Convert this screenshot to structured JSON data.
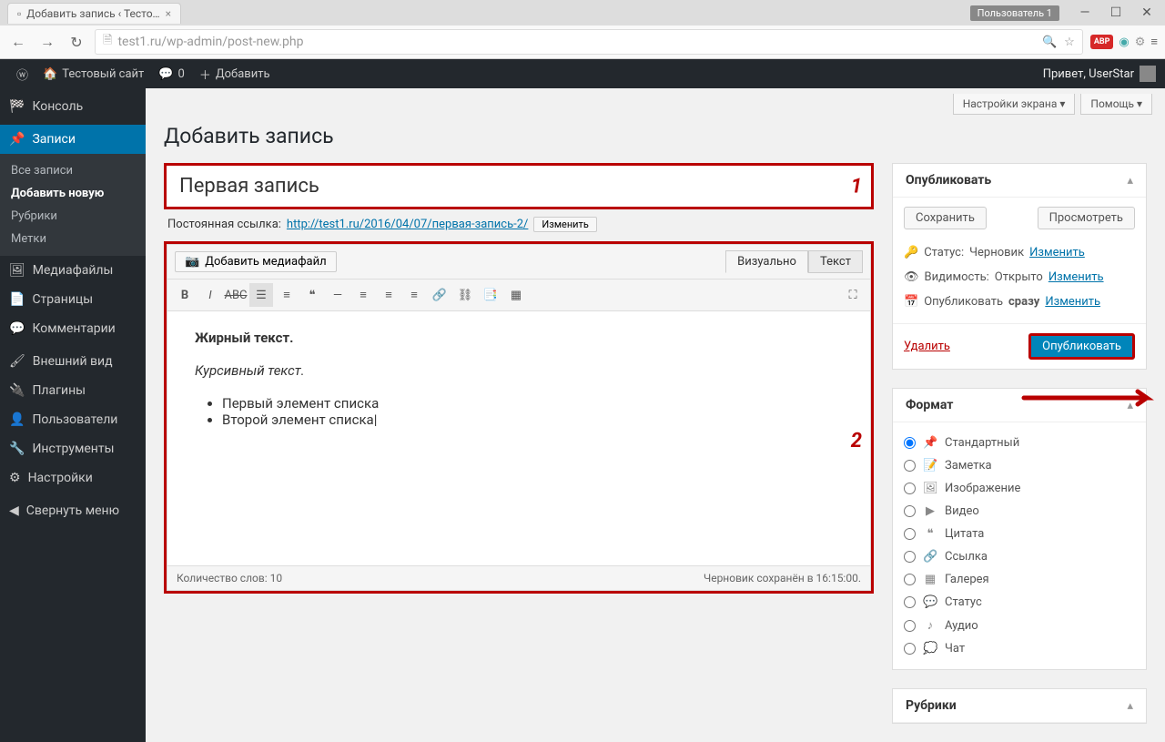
{
  "browser": {
    "tab_title": "Добавить запись ‹ Тесто…",
    "user_badge": "Пользователь 1",
    "url": "test1.ru/wp-admin/post-new.php"
  },
  "adminbar": {
    "site": "Тестовый сайт",
    "comments": "0",
    "add": "Добавить",
    "greeting": "Привет, UserStar"
  },
  "sidebar": {
    "console": "Консоль",
    "posts": "Записи",
    "all_posts": "Все записи",
    "add_new": "Добавить новую",
    "categories": "Рубрики",
    "tags": "Метки",
    "media": "Медиафайлы",
    "pages": "Страницы",
    "comments": "Комментарии",
    "appearance": "Внешний вид",
    "plugins": "Плагины",
    "users": "Пользователи",
    "tools": "Инструменты",
    "settings": "Настройки",
    "collapse": "Свернуть меню"
  },
  "screen": {
    "options": "Настройки экрана",
    "help": "Помощь"
  },
  "page": {
    "title": "Добавить запись",
    "post_title": "Первая запись",
    "permalink_label": "Постоянная ссылка:",
    "permalink_url": "http://test1.ru/2016/04/07/первая-запись-2/",
    "edit": "Изменить",
    "add_media": "Добавить медиафайл",
    "tab_visual": "Визуально",
    "tab_text": "Текст",
    "content_bold": "Жирный текст.",
    "content_italic": "Курсивный текст.",
    "list_item1": "Первый элемент списка",
    "list_item2": "Второй элемент списка",
    "word_count": "Количество слов: 10",
    "draft_saved": "Черновик сохранён в 16:15:00."
  },
  "publish": {
    "title": "Опубликовать",
    "save": "Сохранить",
    "preview": "Просмотреть",
    "status_label": "Статус:",
    "status_value": "Черновик",
    "visibility_label": "Видимость:",
    "visibility_value": "Открыто",
    "schedule_label": "Опубликовать",
    "schedule_value": "сразу",
    "edit": "Изменить",
    "delete": "Удалить",
    "publish_btn": "Опубликовать"
  },
  "format": {
    "title": "Формат",
    "standard": "Стандартный",
    "aside": "Заметка",
    "image": "Изображение",
    "video": "Видео",
    "quote": "Цитата",
    "link": "Ссылка",
    "gallery": "Галерея",
    "status": "Статус",
    "audio": "Аудио",
    "chat": "Чат"
  },
  "categories": {
    "title": "Рубрики"
  },
  "annotations": {
    "n1": "1",
    "n2": "2"
  }
}
